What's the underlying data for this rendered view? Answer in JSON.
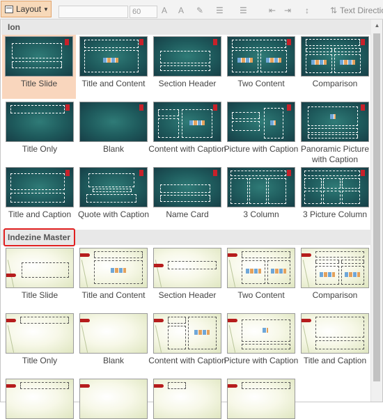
{
  "ribbon": {
    "layout_label": "Layout",
    "font_size": "60",
    "text_direction": "Text Directio"
  },
  "sections": [
    {
      "header": "Ion",
      "layouts": [
        "Title Slide",
        "Title and Content",
        "Section Header",
        "Two Content",
        "Comparison",
        "Title Only",
        "Blank",
        "Content with Caption",
        "Picture with Caption",
        "Panoramic Picture with Caption",
        "Title and Caption",
        "Quote with Caption",
        "Name Card",
        "3 Column",
        "3 Picture Column"
      ]
    },
    {
      "header": "Indezine Master",
      "layouts": [
        "Title Slide",
        "Title and Content",
        "Section Header",
        "Two Content",
        "Comparison",
        "Title Only",
        "Blank",
        "Content with Caption",
        "Picture with Caption",
        "Title and Caption"
      ]
    }
  ],
  "selected_layout": "Title Slide",
  "colors": {
    "teal_theme": "#1e5a5c",
    "cream_theme": "#f7f8e8",
    "selection": "#f9d6bd",
    "highlight_border": "#e01f1f",
    "accent_red": "#c8212a"
  }
}
